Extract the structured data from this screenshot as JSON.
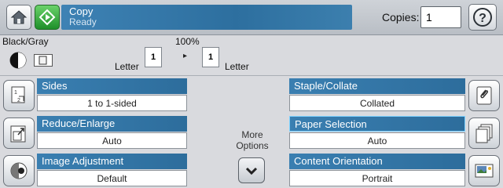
{
  "header": {
    "job_title": "Copy",
    "job_status": "Ready",
    "copies_label": "Copies:",
    "copies_value": "1",
    "icons": [
      "home-icon",
      "start-icon",
      "help-icon"
    ]
  },
  "mode_row": {
    "color_mode_label": "Black/Gray",
    "zoom_label": "100%",
    "source": {
      "count": "1",
      "paper": "Letter"
    },
    "destination": {
      "count": "1",
      "paper": "Letter"
    },
    "arrow": "▸"
  },
  "options": {
    "sides": {
      "title": "Sides",
      "value": "1 to 1-sided"
    },
    "reduce_enlarge": {
      "title": "Reduce/Enlarge",
      "value": "Auto"
    },
    "image_adjustment": {
      "title": "Image Adjustment",
      "value": "Default"
    },
    "staple_collate": {
      "title": "Staple/Collate",
      "value": "Collated"
    },
    "paper_selection": {
      "title": "Paper Selection",
      "value": "Auto"
    },
    "content_orientation": {
      "title": "Content Orientation",
      "value": "Portrait"
    }
  },
  "more_options": {
    "line1": "More",
    "line2": "Options"
  },
  "colors": {
    "header_blue": "#2d6f9f",
    "start_green": "#1e8f2a",
    "selected_outline": "#7fd2ff"
  }
}
